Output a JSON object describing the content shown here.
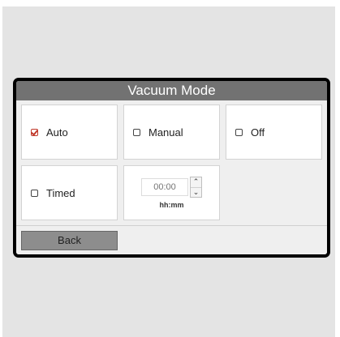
{
  "screen": {
    "title": "Vacuum Mode"
  },
  "options": [
    {
      "label": "Auto",
      "checked": true
    },
    {
      "label": "Manual",
      "checked": false
    },
    {
      "label": "Off",
      "checked": false
    },
    {
      "label": "Timed",
      "checked": false
    }
  ],
  "timer": {
    "value": "00:00",
    "format_label": "hh:mm"
  },
  "footer": {
    "back_label": "Back"
  },
  "colors": {
    "title_bar": "#727272",
    "check_accent": "#c0392b",
    "back_button": "#8d8d8d"
  }
}
